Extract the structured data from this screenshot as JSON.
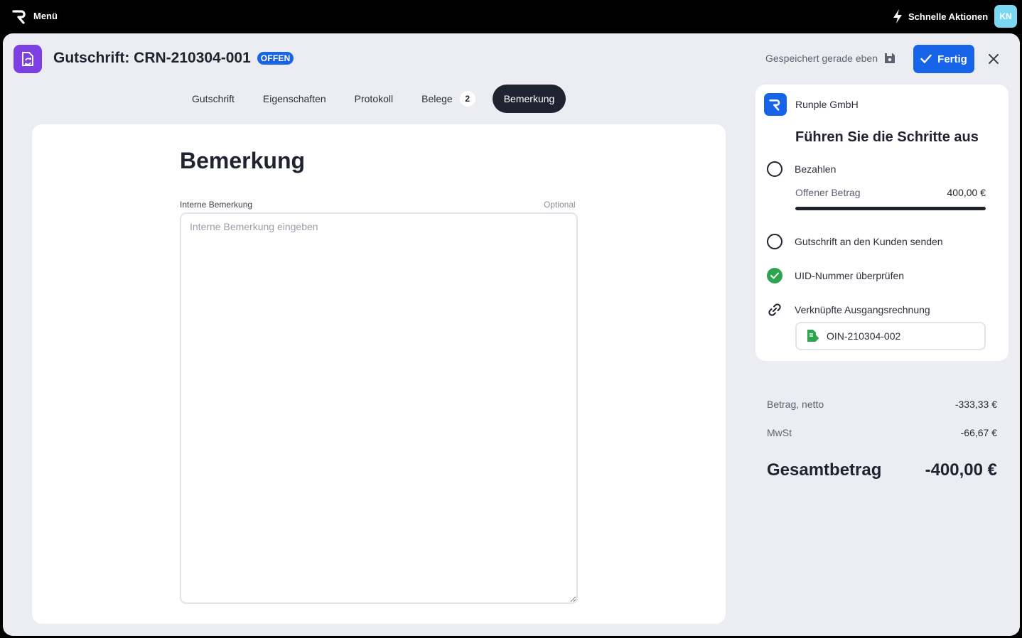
{
  "topbar": {
    "menu_label": "Menü",
    "quick_actions_label": "Schnelle Aktionen",
    "avatar_initials": "KN"
  },
  "header": {
    "title": "Gutschrift: CRN-210304-001",
    "status_badge": "OFFEN",
    "saved_status": "Gespeichert gerade eben",
    "done_label": "Fertig"
  },
  "tabs": [
    {
      "label": "Gutschrift"
    },
    {
      "label": "Eigenschaften"
    },
    {
      "label": "Protokoll"
    },
    {
      "label": "Belege",
      "count": "2"
    },
    {
      "label": "Bemerkung",
      "active": true
    }
  ],
  "note": {
    "title": "Bemerkung",
    "field_label": "Interne Bemerkung",
    "optional_label": "Optional",
    "placeholder": "Interne Bemerkung eingeben",
    "value": ""
  },
  "panel": {
    "company": "Runple GmbH",
    "steps_title": "Führen Sie die Schritte aus",
    "steps": {
      "pay": {
        "label": "Bezahlen",
        "done": false
      },
      "open_amount_label": "Offener Betrag",
      "open_amount_value": "400,00 €",
      "paid_fraction": 1.0,
      "send": {
        "label": "Gutschrift an den Kunden senden",
        "done": false
      },
      "vat": {
        "label": "UID-Nummer überprüfen",
        "done": true
      },
      "linked_label": "Verknüpfte Ausgangsrechnung",
      "linked_doc": "OIN-210304-002"
    }
  },
  "totals": {
    "net_label": "Betrag, netto",
    "net_value": "-333,33 €",
    "vat_label": "MwSt",
    "vat_value": "-66,67 €",
    "gross_label": "Gesamtbetrag",
    "gross_value": "-400,00 €"
  },
  "colors": {
    "accent": "#1764e8",
    "doc_icon": "#7b3fe4",
    "success": "#2da44e",
    "avatar": "#7ad8f4"
  },
  "icons": [
    "runple-logo-icon",
    "lightning-icon",
    "credit-note-icon",
    "save-icon",
    "check-icon",
    "close-icon",
    "link-icon",
    "invoice-icon"
  ]
}
